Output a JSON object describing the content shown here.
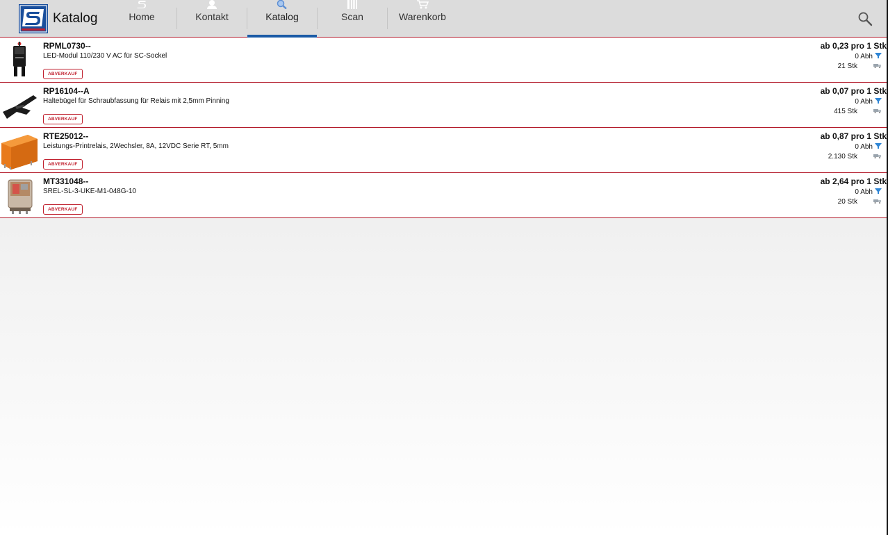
{
  "header": {
    "app_title": "Katalog",
    "tabs": [
      {
        "id": "home",
        "label": "Home",
        "icon": "logo-s-icon",
        "active": false
      },
      {
        "id": "kontakt",
        "label": "Kontakt",
        "icon": "person-icon",
        "active": false
      },
      {
        "id": "katalog",
        "label": "Katalog",
        "icon": "magnifier-icon",
        "active": true
      },
      {
        "id": "scan",
        "label": "Scan",
        "icon": "barcode-icon",
        "active": false
      },
      {
        "id": "warenkorb",
        "label": "Warenkorb",
        "icon": "cart-icon",
        "active": false
      }
    ],
    "search_icon": "search-icon"
  },
  "colors": {
    "accent_blue": "#1a5aa6",
    "divider_red": "#b31b2b",
    "badge_red": "#c0202e"
  },
  "products": [
    {
      "sku": "RPML0730--",
      "description": "LED-Modul 110/230 V AC für SC-Sockel",
      "badge": "ABVERKAUF",
      "price": "ab 0,23 pro 1 Stk",
      "abh": "0 Abh",
      "stock": "21 Stk",
      "image": "led-module-image"
    },
    {
      "sku": "RP16104--A",
      "description": "Haltebügel für Schraubfassung für Relais mit 2,5mm Pinning",
      "badge": "ABVERKAUF",
      "price": "ab 0,07 pro 1 Stk",
      "abh": "0 Abh",
      "stock": "415 Stk",
      "image": "retaining-clip-image"
    },
    {
      "sku": "RTE25012--",
      "description": "Leistungs-Printrelais, 2Wechsler, 8A, 12VDC Serie RT, 5mm",
      "badge": "ABVERKAUF",
      "price": "ab 0,87 pro 1 Stk",
      "abh": "0 Abh",
      "stock": "2.130 Stk",
      "image": "orange-relay-image"
    },
    {
      "sku": "MT331048--",
      "description": "SREL-SL-3-UKE-M1-048G-10",
      "badge": "ABVERKAUF",
      "price": "ab 2,64 pro 1 Stk",
      "abh": "0 Abh",
      "stock": "20 Stk",
      "image": "plug-in-relay-image"
    }
  ]
}
